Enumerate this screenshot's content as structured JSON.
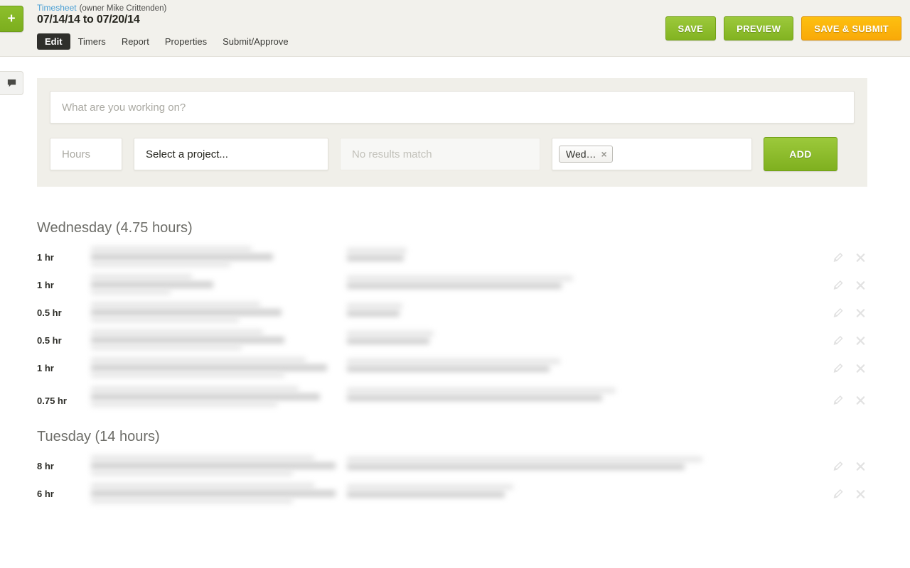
{
  "header": {
    "add_button_label": "+",
    "breadcrumb_link": "Timesheet",
    "breadcrumb_owner": "(owner Mike Crittenden)",
    "date_range": "07/14/14 to 07/20/14",
    "tabs": [
      {
        "label": "Edit",
        "active": true
      },
      {
        "label": "Timers",
        "active": false
      },
      {
        "label": "Report",
        "active": false
      },
      {
        "label": "Properties",
        "active": false
      },
      {
        "label": "Submit/Approve",
        "active": false
      }
    ],
    "actions": [
      {
        "label": "SAVE",
        "style": "green"
      },
      {
        "label": "PREVIEW",
        "style": "green"
      },
      {
        "label": "SAVE & SUBMIT",
        "style": "orange"
      }
    ],
    "colors": {
      "green": "#8ebb2a",
      "orange": "#f9a908",
      "link": "#4a9fd4",
      "bg": "#f2f1ec",
      "tab_active_bg": "#2f2f2b"
    }
  },
  "side_tab": {
    "icon": "comment-icon"
  },
  "entry_form": {
    "description_placeholder": "What are you working on?",
    "hours_placeholder": "Hours",
    "project_placeholder": "Select a project...",
    "task_placeholder": "No results match",
    "date_chip_label": "Wed…",
    "date_chip_remove": "×",
    "add_label": "ADD",
    "panel_bg": "#f0efe9"
  },
  "days": [
    {
      "title": "Wednesday (4.75 hours)",
      "entries": [
        {
          "hours": "1 hr",
          "desc_w": 256,
          "proj_w": 84,
          "tall": false
        },
        {
          "hours": "1 hr",
          "desc_w": 172,
          "proj_w": 318,
          "tall": false
        },
        {
          "hours": "0.5 hr",
          "desc_w": 268,
          "proj_w": 78,
          "tall": false
        },
        {
          "hours": "0.5 hr",
          "desc_w": 272,
          "proj_w": 122,
          "tall": false
        },
        {
          "hours": "1 hr",
          "desc_w": 332,
          "proj_w": 300,
          "tall": false
        },
        {
          "hours": "0.75 hr",
          "desc_w": 322,
          "proj_w": 378,
          "tall": true
        }
      ]
    },
    {
      "title": "Tuesday (14 hours)",
      "entries": [
        {
          "hours": "8 hr",
          "desc_w": 344,
          "proj_w": 500,
          "tall": false
        },
        {
          "hours": "6 hr",
          "desc_w": 344,
          "proj_w": 234,
          "tall": false
        }
      ]
    }
  ],
  "row_icons": {
    "edit": "pencil-icon",
    "delete": "close-icon"
  }
}
